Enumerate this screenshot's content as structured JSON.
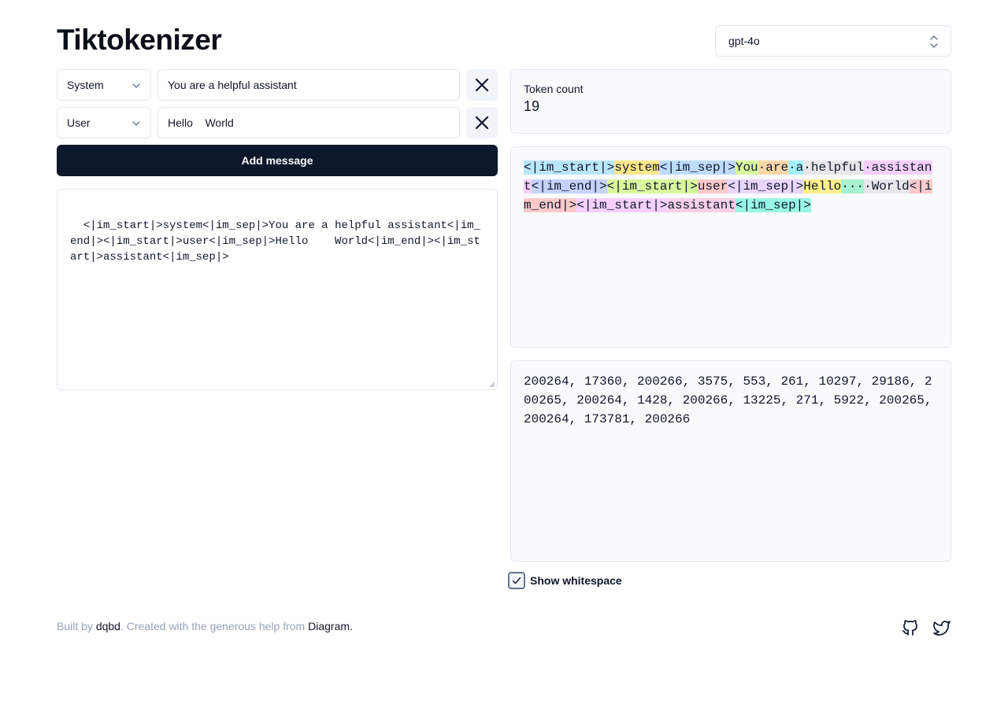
{
  "app": {
    "title": "Tiktokenizer"
  },
  "model_select": {
    "value": "gpt-4o"
  },
  "messages": [
    {
      "role": "System",
      "content": "You are a helpful assistant"
    },
    {
      "role": "User",
      "content": "Hello    World"
    }
  ],
  "add_button_label": "Add message",
  "prompt_text": "<|im_start|>system<|im_sep|>You are a helpful assistant<|im_end|><|im_start|>user<|im_sep|>Hello    World<|im_end|><|im_start|>assistant<|im_sep|>",
  "token_count": {
    "label": "Token count",
    "value": "19"
  },
  "tokens": [
    {
      "text": "<|im_start|>",
      "color": "#bae6fd"
    },
    {
      "text": "system",
      "color": "#fde68a"
    },
    {
      "text": "<|im_sep|>",
      "color": "#bfdbfe"
    },
    {
      "text": "You",
      "color": "#d9f99d"
    },
    {
      "text": "·are",
      "color": "#fed7aa"
    },
    {
      "text": "·a",
      "color": "#a5f3fc"
    },
    {
      "text": "·helpful",
      "color": "#e5e7eb"
    },
    {
      "text": "·assistant",
      "color": "#f5d0fe"
    },
    {
      "text": "<|im_end|>",
      "color": "#c7d2fe"
    },
    {
      "text": "<|im_start|>",
      "color": "#d9f99d"
    },
    {
      "text": "user",
      "color": "#fecaca"
    },
    {
      "text": "<|im_sep|>",
      "color": "#e9d5ff"
    },
    {
      "text": "Hello",
      "color": "#fef08a"
    },
    {
      "text": "···",
      "color": "#a7f3d0"
    },
    {
      "text": "·World",
      "color": "#e5e7eb"
    },
    {
      "text": "<|im_end|>",
      "color": "#fecaca"
    },
    {
      "text": "<|im_start|>",
      "color": "#f5d0fe"
    },
    {
      "text": "assistant",
      "color": "#fbcfe8"
    },
    {
      "text": "<|im_sep|>",
      "color": "#99f6e4"
    }
  ],
  "token_ids_text": "200264, 17360, 200266, 3575, 553, 261, 10297, 29186, 200265, 200264, 1428, 200266, 13225, 271, 5922, 200265, 200264, 173781, 200266",
  "show_whitespace": {
    "label": "Show whitespace",
    "checked": true
  },
  "footer": {
    "built_by_prefix": "Built by ",
    "author": "dqbd",
    "created_text": ". Created with the generous help from ",
    "helper": "Diagram",
    "end": "."
  },
  "icons": [
    "github-icon",
    "twitter-icon",
    "close-icon",
    "chevron-down-icon",
    "chevron-up-down-icon",
    "check-icon"
  ]
}
